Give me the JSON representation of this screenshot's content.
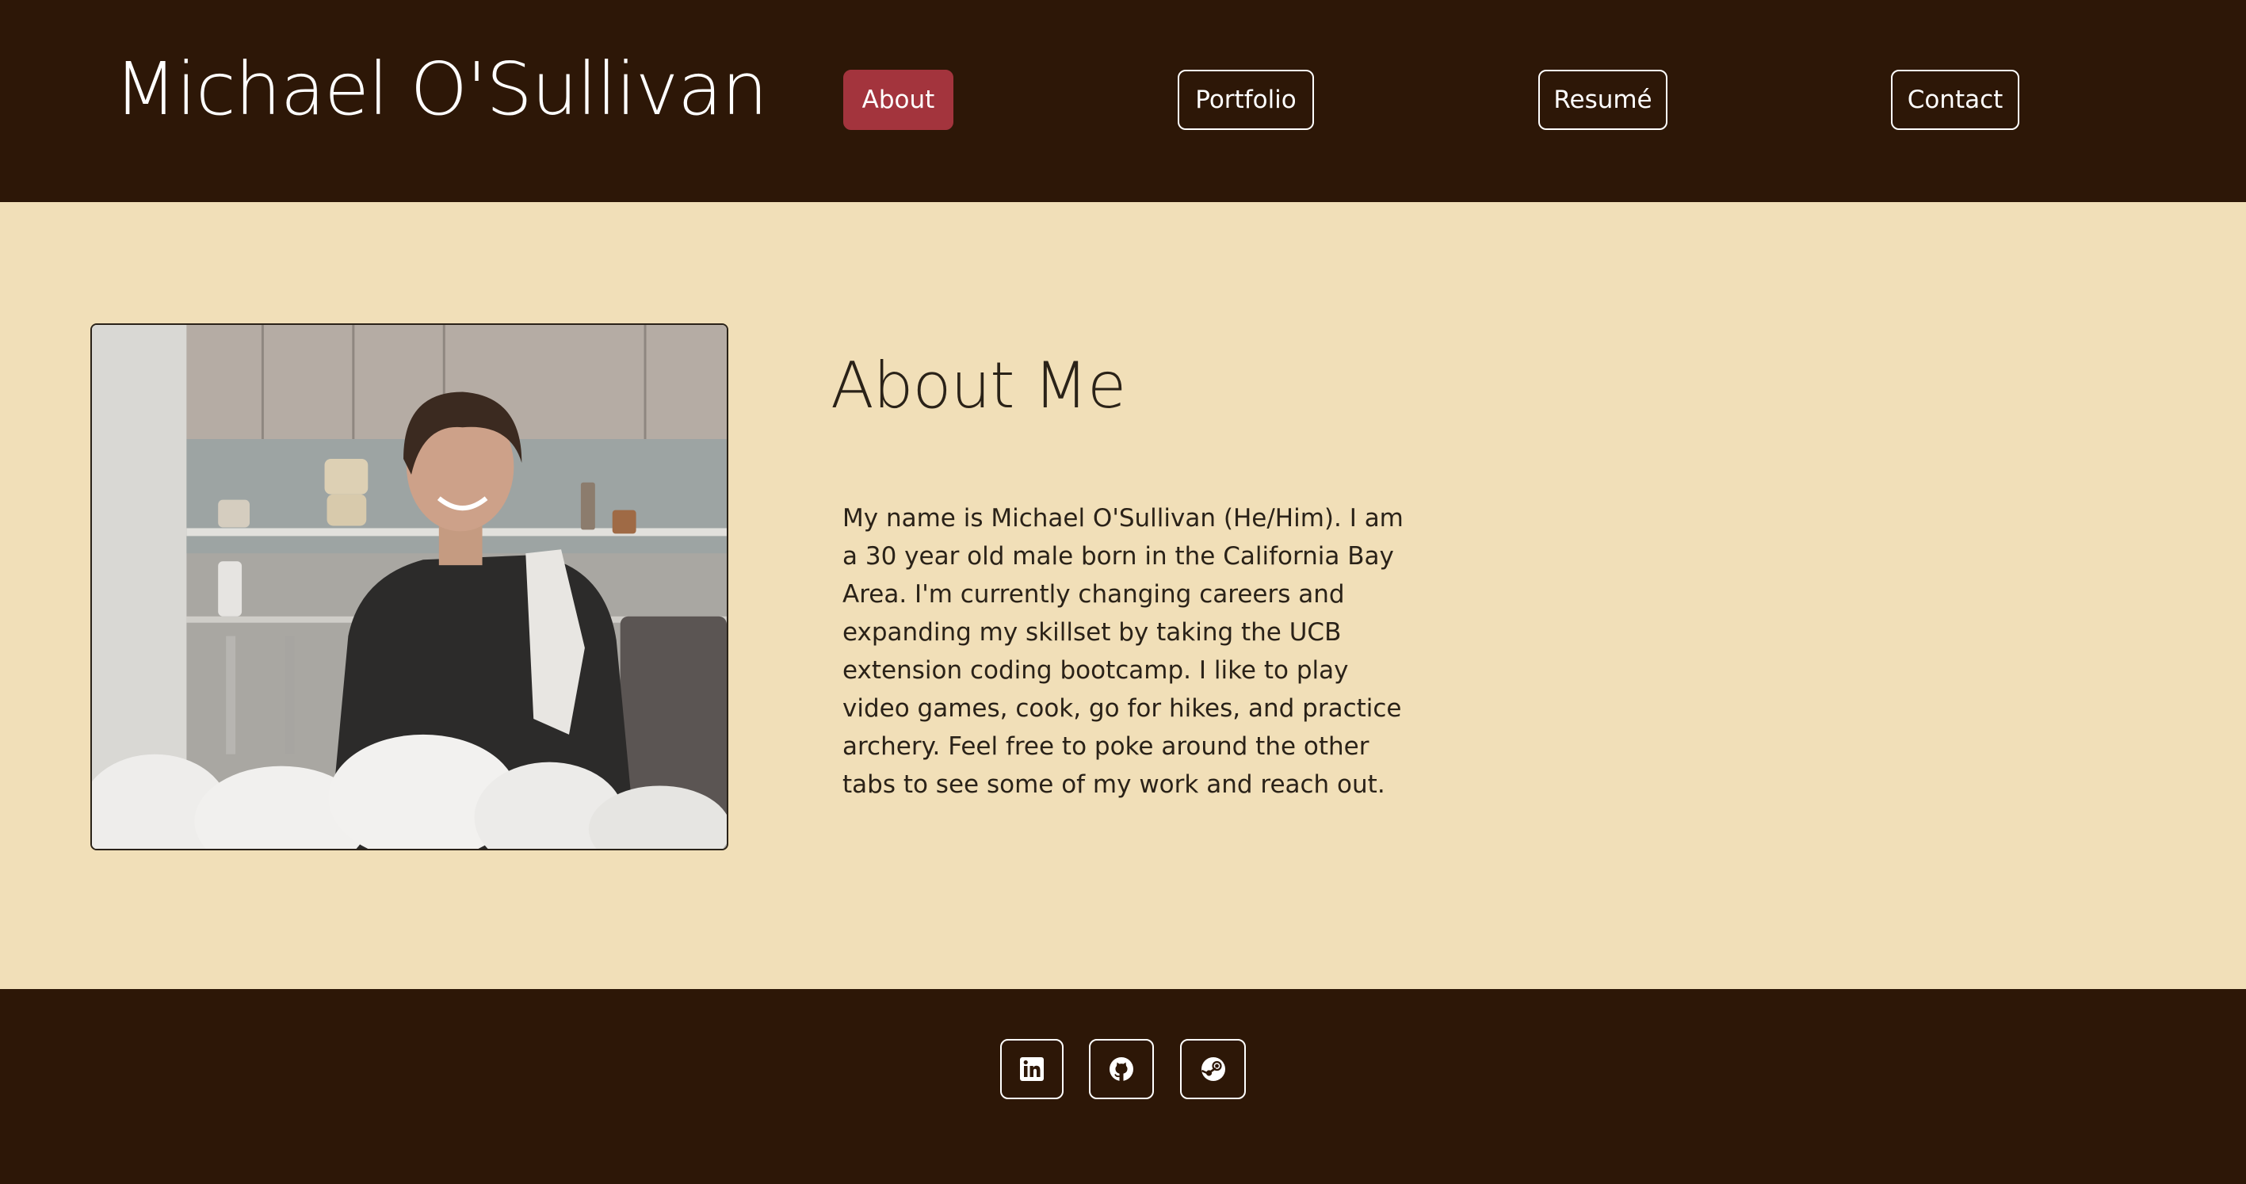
{
  "header": {
    "site_title": "Michael O'Sullivan",
    "nav": [
      {
        "label": "About",
        "active": true
      },
      {
        "label": "Portfolio",
        "active": false
      },
      {
        "label": "Resumé",
        "active": false
      },
      {
        "label": "Contact",
        "active": false
      }
    ]
  },
  "about": {
    "heading": "About Me",
    "body": "My name is Michael O'Sullivan (He/Him). I am a 30 year old male born in the California Bay Area. I'm currently changing careers and expanding my skillset by taking the UCB extension coding bootcamp. I like to play video games, cook, go for hikes, and practice archery. Feel free to poke around the other tabs to see some of my work and reach out."
  },
  "footer": {
    "social_icons": [
      "linkedin-icon",
      "github-icon",
      "steam-icon"
    ]
  },
  "colors": {
    "header_bg": "#2d1707",
    "page_bg": "#f1dfb8",
    "active_nav": "#a3343d",
    "text": "#2a2218"
  }
}
